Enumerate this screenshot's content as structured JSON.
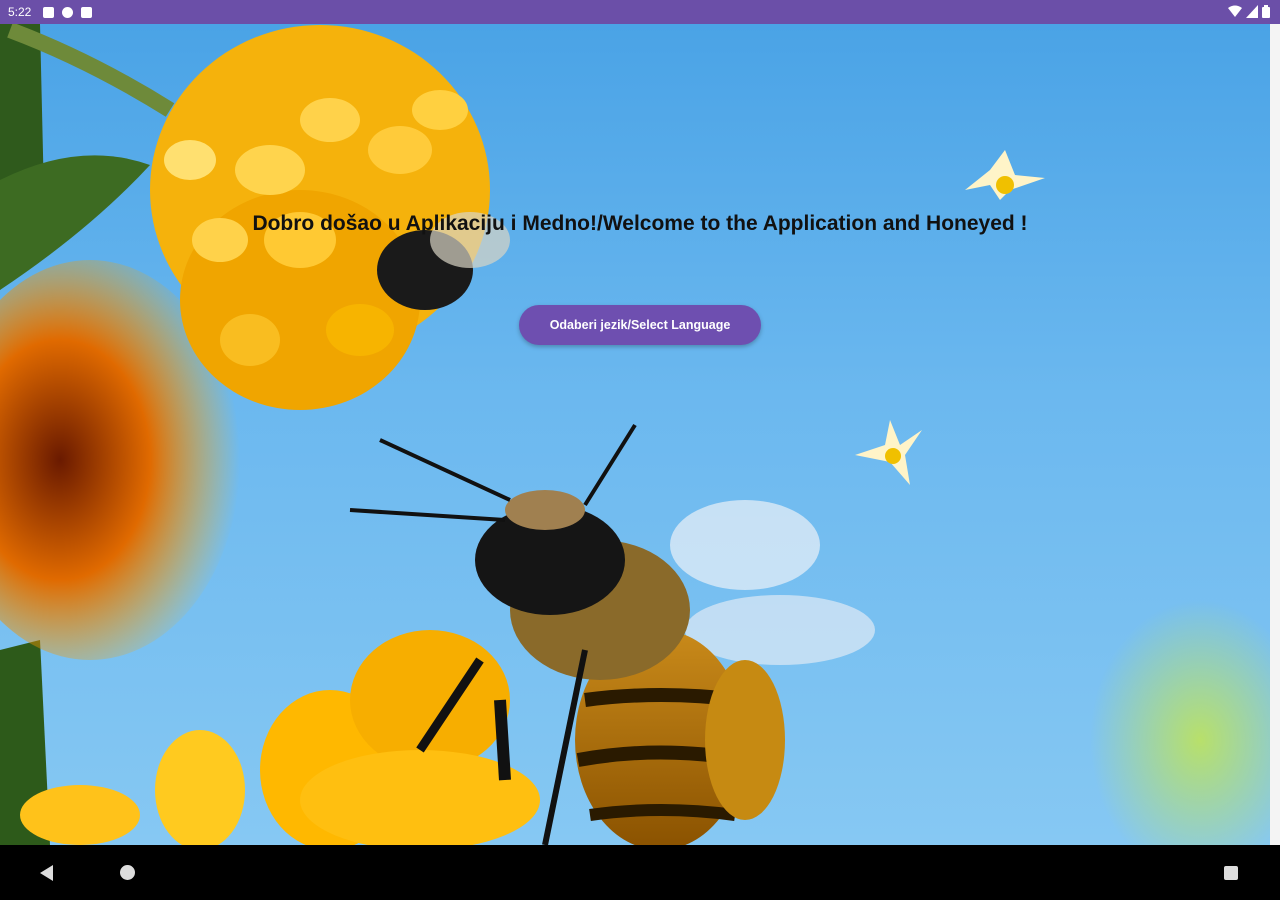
{
  "status_bar": {
    "time": "5:22",
    "left_icons": [
      "notification-icon",
      "app-icon",
      "sd-card-icon"
    ],
    "right_icons": [
      "wifi-icon",
      "signal-icon",
      "battery-icon"
    ]
  },
  "main": {
    "welcome_text": "Dobro došao u Aplikaciju i Medno!/Welcome to the Application and Honeyed !",
    "select_language_label": "Odaberi jezik/Select Language"
  },
  "nav_bar": {
    "icons": [
      "back-icon",
      "home-icon",
      "recents-icon"
    ]
  },
  "colors": {
    "status_bar": "#6b4fa8",
    "button": "#6e4fb0",
    "sky": "#6bb8ef"
  }
}
